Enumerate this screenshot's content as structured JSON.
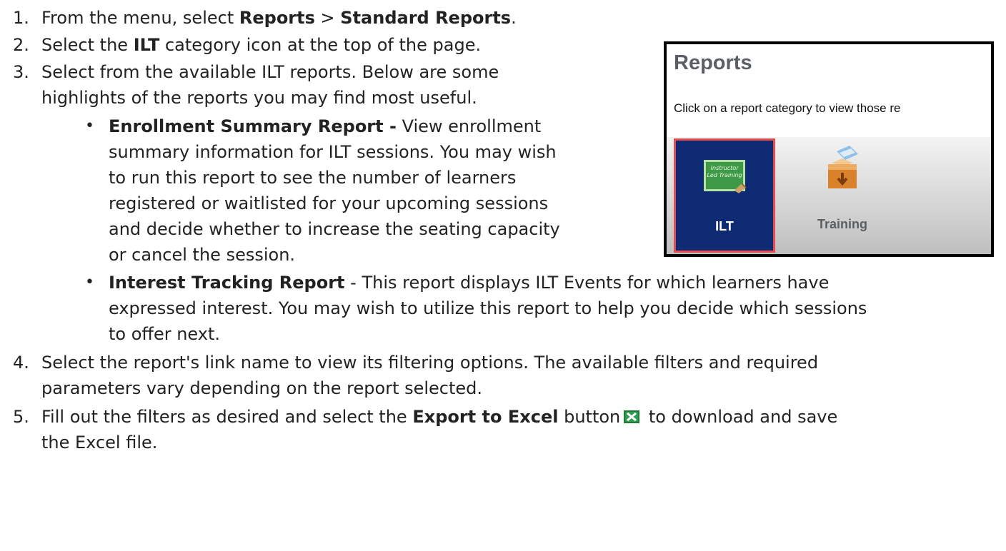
{
  "steps": [
    {
      "number": "1.",
      "text_before": "From the menu, select ",
      "bold_1": "Reports",
      "separator": " > ",
      "bold_2": "Standard Reports",
      "end": "."
    },
    {
      "number": "2.",
      "text_before": "Select the ",
      "bold": "ILT",
      "text_after": " category icon at the top of the page."
    },
    {
      "number": "3.",
      "line_1": "Select from the available ILT reports. Below are some",
      "line_2": "highlights of the reports you may find most useful."
    },
    {
      "number": "4.",
      "line_1": "Select the report's link name to view its filtering options. The available filters and required",
      "line_2": "parameters vary depending on the report selected."
    },
    {
      "number": "5.",
      "text_before": "Fill out the filters as desired and select the ",
      "bold": "Export to Excel",
      "text_after": " button",
      "text_after_icon": " to download and save",
      "line_2": "the Excel file."
    }
  ],
  "reports": [
    {
      "bullet": "•",
      "name": "Enrollment Summary Report -",
      "lines": [
        " View enrollment",
        "summary information for ILT sessions. You may wish",
        "to run this report to see the number of learners",
        "registered or waitlisted for your upcoming sessions",
        "and decide whether to increase the seating capacity",
        "or cancel the session."
      ]
    },
    {
      "bullet": "•",
      "name": "Interest Tracking Report",
      "lines": [
        " - This report displays ILT Events for which learners have",
        "expressed interest. You may wish to utilize this report to help you decide which sessions",
        "to offer next."
      ]
    }
  ],
  "screenshot": {
    "title": "Reports",
    "subtitle": "Click on a report category to view those re",
    "tiles": [
      {
        "label": "ILT",
        "icon": "chalkboard-icon",
        "board_text": "Instructor Led Training",
        "selected": true
      },
      {
        "label": "Training",
        "icon": "training-box-icon",
        "selected": false
      }
    ]
  },
  "icons": {
    "export": "excel-icon"
  },
  "colors": {
    "text": "#222222",
    "tile_selected_bg": "#0e2a73",
    "highlight_border": "#e74c4c",
    "title_gray": "#5b5f63"
  }
}
